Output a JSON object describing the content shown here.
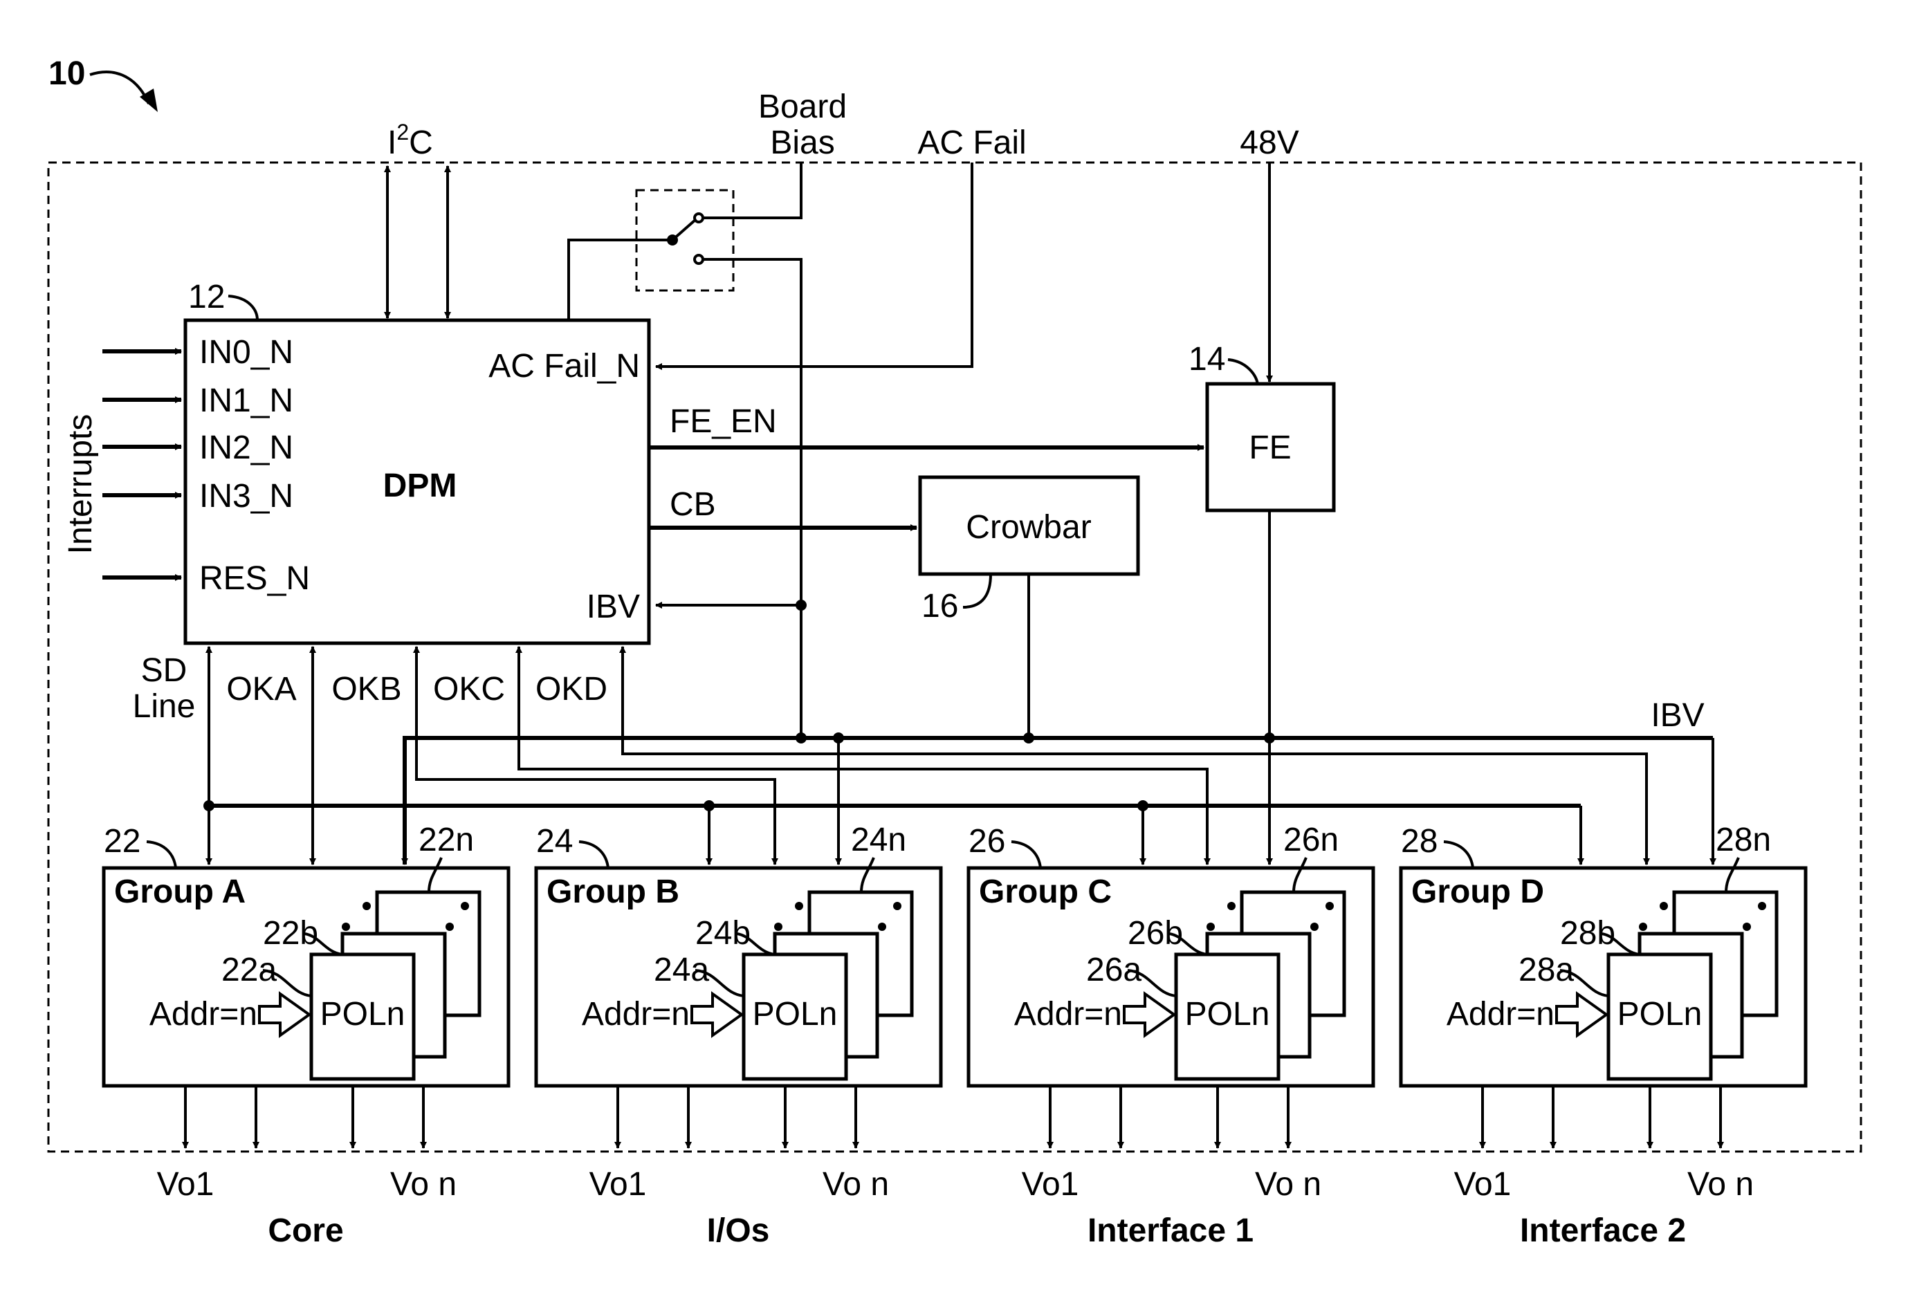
{
  "figure": {
    "ref_number": "10",
    "top_inputs": {
      "i2c": {
        "base": "I",
        "sup": "2",
        "rest": "C"
      },
      "board_bias": [
        "Board",
        "Bias"
      ],
      "ac_fail": "AC Fail",
      "v48": "48V"
    },
    "dpm": {
      "ref": "12",
      "title": "DPM",
      "side_label": "Interrupts",
      "inputs": [
        "IN0_N",
        "IN1_N",
        "IN2_N",
        "IN3_N",
        "RES_N"
      ],
      "right_pins": {
        "ac_fail_n": "AC Fail_N",
        "ibv": "IBV"
      },
      "out_signals": {
        "fe_en": "FE_EN",
        "cb": "CB"
      },
      "bottom_signals": {
        "sd_line": [
          "SD",
          "Line"
        ],
        "oka": "OKA",
        "okb": "OKB",
        "okc": "OKC",
        "okd": "OKD"
      }
    },
    "fe": {
      "ref": "14",
      "label": "FE"
    },
    "crowbar": {
      "ref": "16",
      "label": "Crowbar"
    },
    "ibv_bus_label": "IBV",
    "groups": [
      {
        "ref": "22",
        "title": "Group A",
        "pol_n_ref": "22n",
        "pol_b_ref": "22b",
        "pol_a_ref": "22a",
        "addr": "Addr=n",
        "pol_label": "POLn",
        "out_first": "Vo1",
        "out_last": "Vo n",
        "domain": "Core"
      },
      {
        "ref": "24",
        "title": "Group B",
        "pol_n_ref": "24n",
        "pol_b_ref": "24b",
        "pol_a_ref": "24a",
        "addr": "Addr=n",
        "pol_label": "POLn",
        "out_first": "Vo1",
        "out_last": "Vo n",
        "domain": "I/Os"
      },
      {
        "ref": "26",
        "title": "Group C",
        "pol_n_ref": "26n",
        "pol_b_ref": "26b",
        "pol_a_ref": "26a",
        "addr": "Addr=n",
        "pol_label": "POLn",
        "out_first": "Vo1",
        "out_last": "Vo n",
        "domain": "Interface 1"
      },
      {
        "ref": "28",
        "title": "Group D",
        "pol_n_ref": "28n",
        "pol_b_ref": "28b",
        "pol_a_ref": "28a",
        "addr": "Addr=n",
        "pol_label": "POLn",
        "out_first": "Vo1",
        "out_last": "Vo n",
        "domain": "Interface 2"
      }
    ]
  }
}
